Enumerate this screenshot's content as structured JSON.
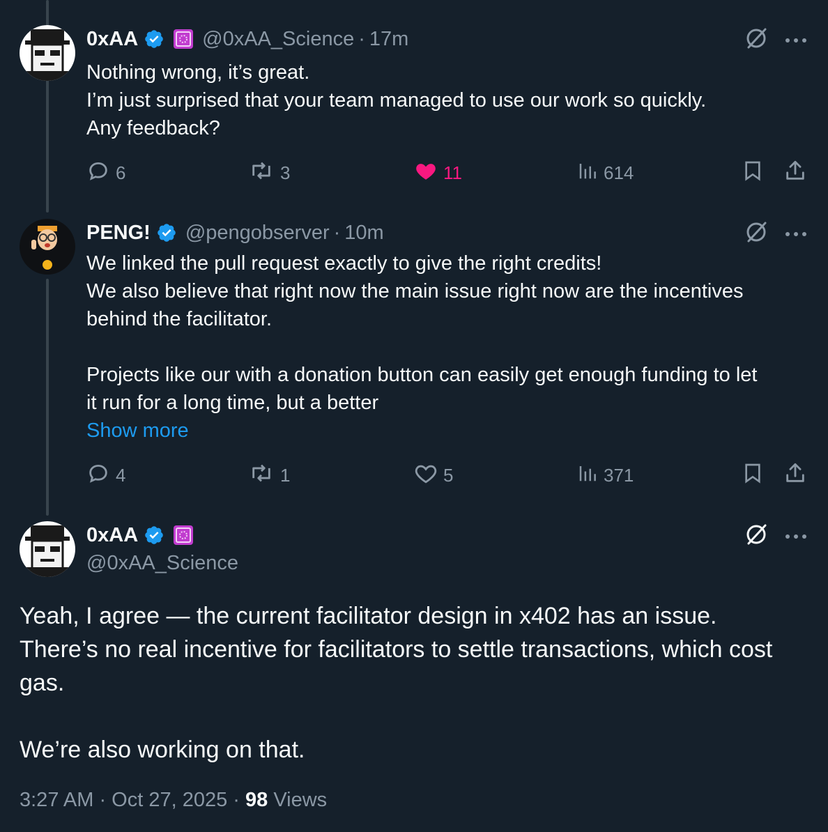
{
  "tweets": [
    {
      "name": "0xAA",
      "handle": "@0xAA_Science",
      "time": "17m",
      "text": [
        "Nothing wrong, it’s great.",
        "I’m just surprised that your team managed to use our work so quickly.",
        "Any feedback?"
      ],
      "replies": "6",
      "reposts": "3",
      "likes": "11",
      "views": "614",
      "liked": true
    },
    {
      "name": "PENG!",
      "handle": "@pengobserver",
      "time": "10m",
      "text": [
        "We linked the pull request exactly to give the right credits!",
        "We also believe that right now the main issue right now are the incentives",
        "behind the facilitator.",
        "",
        "Projects like our with a donation button can easily get enough funding to let",
        "it run for a long time, but a better"
      ],
      "show_more": "Show more",
      "replies": "4",
      "reposts": "1",
      "likes": "5",
      "views": "371",
      "liked": false
    }
  ],
  "main_tweet": {
    "name": "0xAA",
    "handle": "@0xAA_Science",
    "text": [
      "Yeah, I agree — the current facilitator design in x402 has an issue.",
      "There’s no real incentive for facilitators to settle transactions, which cost",
      "gas.",
      "",
      "We’re also working on that."
    ],
    "timestamp": "3:27 AM · Oct 27, 2025 · ",
    "views_count": "98",
    "views_label": " Views"
  },
  "separator": "·",
  "colors": {
    "background": "#15202b",
    "accent": "#1d9bf0",
    "like": "#f91880",
    "muted": "#8b98a5",
    "affiliate_badge": "#c13ccf"
  },
  "icons": [
    "verified-badge-icon",
    "affiliate-badge-icon",
    "grok-icon",
    "more-icon",
    "reply-icon",
    "repost-icon",
    "like-icon",
    "views-icon",
    "bookmark-icon",
    "share-icon"
  ]
}
